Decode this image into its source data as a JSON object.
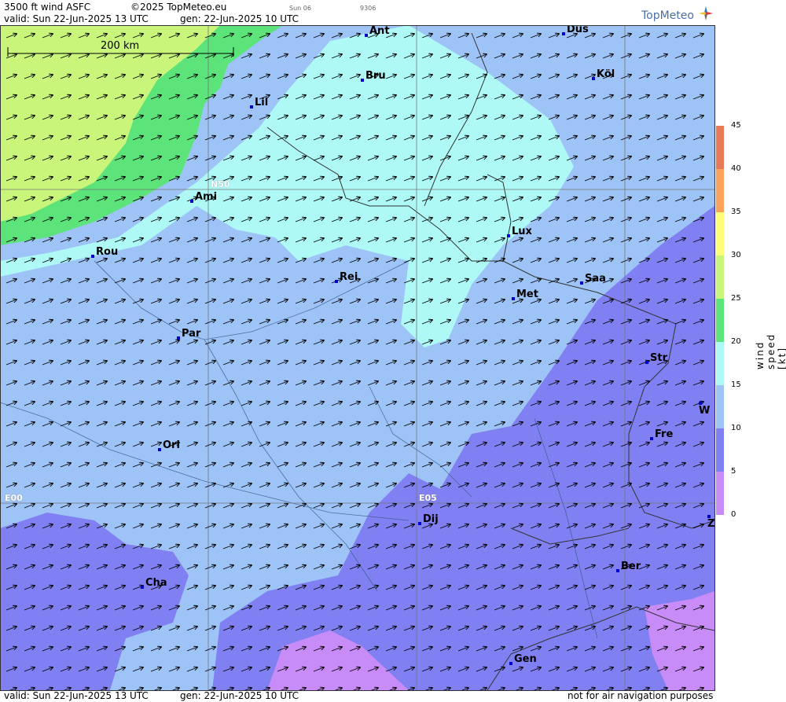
{
  "header": {
    "product": "3500 ft wind ASFC",
    "copyright": "©2025 TopMeteo.eu",
    "sun_tag": "Sun 06",
    "code": "9306",
    "valid": "valid:  Sun  22-Jun-2025  13 UTC",
    "gen": "gen: 22-Jun-2025 10 UTC",
    "logo": "TopMeteo"
  },
  "footer": {
    "valid": "valid:  Sun  22-Jun-2025  13 UTC",
    "gen": "gen: 22-Jun-2025 10 UTC",
    "disclaimer": "not for air navigation purposes"
  },
  "map": {
    "scale_label": "200 km",
    "grid_labels": [
      "N50",
      "E00",
      "E05"
    ],
    "cities": [
      "Ant",
      "Düs",
      "Bru",
      "Köl",
      "Lil",
      "Ami",
      "Rou",
      "Lux",
      "Rei",
      "Saa",
      "Met",
      "Par",
      "Str",
      "W",
      "Fre",
      "Orl",
      "Dij",
      "Cha",
      "Ber",
      "Gen",
      "Z"
    ],
    "wind_direction": "south-west"
  },
  "legend": {
    "unit": "wind  speed  [kt]",
    "ticks": [
      "45",
      "40",
      "35",
      "30",
      "25",
      "20",
      "15",
      "10",
      "5",
      "0"
    ],
    "colors": [
      "#e87a5a",
      "#f9a25b",
      "#fdde5a",
      "#fdfd78",
      "#c8f57a",
      "#5ce37a",
      "#aef9f6",
      "#9ec3f6",
      "#8080f2",
      "#c88cf8"
    ]
  }
}
